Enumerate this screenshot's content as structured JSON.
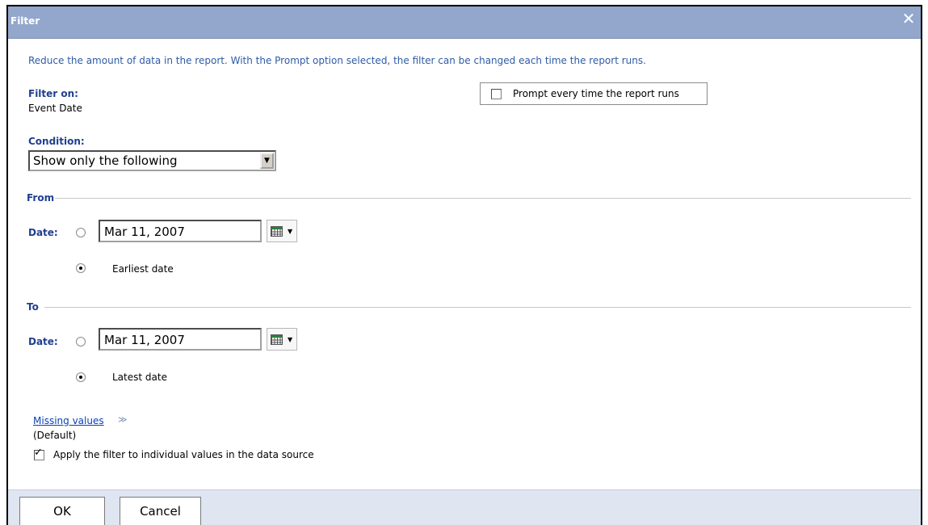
{
  "dialog": {
    "title": "Filter",
    "close_label": "✕",
    "description": "Reduce the amount of data in the report. With the Prompt option selected, the filter can be changed each time the report runs."
  },
  "filter_on": {
    "label": "Filter on:",
    "value": "Event Date"
  },
  "prompt": {
    "label": "Prompt every time the report runs",
    "checked": false
  },
  "condition": {
    "label": "Condition:",
    "selected": "Show only the following"
  },
  "from": {
    "section_label": "From",
    "date_label": "Date:",
    "date_value": "Mar 11, 2007",
    "alt_option_label": "Earliest date",
    "selected_option": "Earliest date"
  },
  "to": {
    "section_label": "To",
    "date_label": "Date:",
    "date_value": "Mar 11, 2007",
    "alt_option_label": "Latest date",
    "selected_option": "Latest date"
  },
  "missing_values": {
    "link_label": "Missing values",
    "chevron": "≫",
    "value": "(Default)"
  },
  "apply_filter": {
    "label": "Apply the filter to individual values in the data source",
    "checked": true,
    "tick": "✓"
  },
  "buttons": {
    "ok_label": "OK",
    "cancel_label": "Cancel"
  },
  "icons": {
    "close": "close-icon",
    "calendar": "calendar-icon",
    "dropdown": "chevron-down-icon"
  },
  "colors": {
    "titlebar": "#93a6cb",
    "label_blue": "#1f3f8f",
    "link_blue": "#0a3fb5",
    "footer": "#dfe6f2"
  }
}
